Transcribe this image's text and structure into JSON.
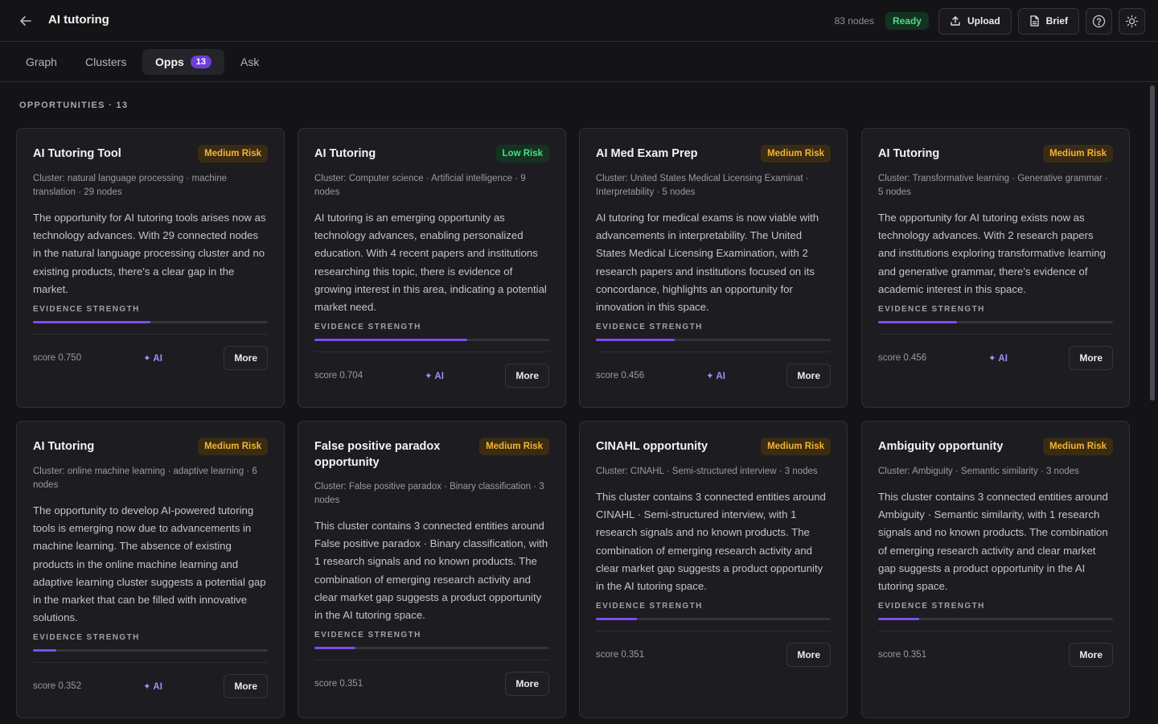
{
  "header": {
    "title": "AI tutoring",
    "node_count": "83 nodes",
    "status": "Ready",
    "upload_label": "Upload",
    "brief_label": "Brief"
  },
  "tabs": [
    {
      "label": "Graph"
    },
    {
      "label": "Clusters"
    },
    {
      "label": "Opps",
      "badge": "13"
    },
    {
      "label": "Ask"
    }
  ],
  "section": {
    "title": "OPPORTUNITIES · 13"
  },
  "evidence_label": "EVIDENCE STRENGTH",
  "more_label": "More",
  "ai_label": "✦ AI",
  "cards": [
    {
      "title": "AI Tutoring Tool",
      "risk": "Medium Risk",
      "cluster": "Cluster: natural language processing · machine translation · 29 nodes",
      "description": "The opportunity for AI tutoring tools arises now as technology advances. With 29 connected nodes in the natural language processing cluster and no existing products, there's a clear gap in the market.",
      "evidence": 0.5,
      "score": "score 0.750",
      "ai": true
    },
    {
      "title": "AI Tutoring",
      "risk": "Low Risk",
      "cluster": "Cluster: Computer science · Artificial intelligence · 9 nodes",
      "description": "AI tutoring is an emerging opportunity as technology advances, enabling personalized education. With 4 recent papers and institutions researching this topic, there is evidence of growing interest in this area, indicating a potential market need.",
      "evidence": 0.65,
      "score": "score 0.704",
      "ai": true
    },
    {
      "title": "AI Med Exam Prep",
      "risk": "Medium Risk",
      "cluster": "Cluster: United States Medical Licensing Examinat · Interpretability · 5 nodes",
      "description": "AI tutoring for medical exams is now viable with advancements in interpretability. The United States Medical Licensing Examination, with 2 research papers and institutions focused on its concordance, highlights an opportunity for innovation in this space.",
      "evidence": 0.335,
      "score": "score 0.456",
      "ai": true
    },
    {
      "title": "AI Tutoring",
      "risk": "Medium Risk",
      "cluster": "Cluster: Transformative learning · Generative grammar · 5 nodes",
      "description": "The opportunity for AI tutoring exists now as technology advances. With 2 research papers and institutions exploring transformative learning and generative grammar, there's evidence of academic interest in this space.",
      "evidence": 0.335,
      "score": "score 0.456",
      "ai": true
    },
    {
      "title": "AI Tutoring",
      "risk": "Medium Risk",
      "cluster": "Cluster: online machine learning · adaptive learning · 6 nodes",
      "description": "The opportunity to develop AI-powered tutoring tools is emerging now due to advancements in machine learning. The absence of existing products in the online machine learning and adaptive learning cluster suggests a potential gap in the market that can be filled with innovative solutions.",
      "evidence": 0.1,
      "score": "score 0.352",
      "ai": true
    },
    {
      "title": "False positive paradox opportunity",
      "risk": "Medium Risk",
      "cluster": "Cluster: False positive paradox · Binary classification · 3 nodes",
      "description": "This cluster contains 3 connected entities around False positive paradox · Binary classification, with 1 research signals and no known products. The combination of emerging research activity and clear market gap suggests a product opportunity in the AI tutoring space.",
      "evidence": 0.175,
      "score": "score 0.351",
      "ai": false
    },
    {
      "title": "CINAHL opportunity",
      "risk": "Medium Risk",
      "cluster": "Cluster: CINAHL · Semi-structured interview · 3 nodes",
      "description": "This cluster contains 3 connected entities around CINAHL · Semi-structured interview, with 1 research signals and no known products. The combination of emerging research activity and clear market gap suggests a product opportunity in the AI tutoring space.",
      "evidence": 0.175,
      "score": "score 0.351",
      "ai": false
    },
    {
      "title": "Ambiguity opportunity",
      "risk": "Medium Risk",
      "cluster": "Cluster: Ambiguity · Semantic similarity · 3 nodes",
      "description": "This cluster contains 3 connected entities around Ambiguity · Semantic similarity, with 1 research signals and no known products. The combination of emerging research activity and clear market gap suggests a product opportunity in the AI tutoring space.",
      "evidence": 0.175,
      "score": "score 0.351",
      "ai": false
    }
  ]
}
